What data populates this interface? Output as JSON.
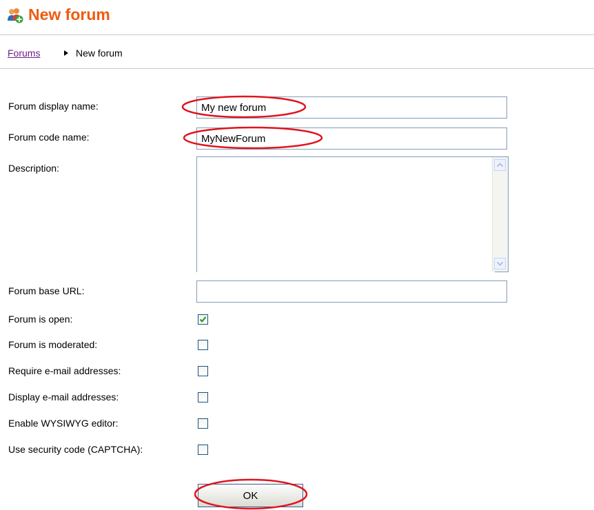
{
  "header": {
    "title": "New forum",
    "icon": "add-group-icon",
    "title_color": "#f05a0e"
  },
  "breadcrumb": {
    "link": "Forums",
    "separator_icon": "triangle-right-icon",
    "current": "New forum"
  },
  "form": {
    "display_name": {
      "label": "Forum display name:",
      "value": "My new forum"
    },
    "code_name": {
      "label": "Forum code name:",
      "value": "MyNewForum"
    },
    "description": {
      "label": "Description:",
      "value": ""
    },
    "base_url": {
      "label": "Forum base URL:",
      "value": ""
    },
    "checkboxes": [
      {
        "label": "Forum is open:",
        "checked": true
      },
      {
        "label": "Forum is moderated:",
        "checked": false
      },
      {
        "label": "Require e-mail addresses:",
        "checked": false
      },
      {
        "label": "Display e-mail addresses:",
        "checked": false
      },
      {
        "label": "Enable WYSIWYG editor:",
        "checked": false
      },
      {
        "label": "Use security code (CAPTCHA):",
        "checked": false
      }
    ],
    "ok_label": "OK"
  },
  "annotations": {
    "color": "#e0141e",
    "highlighted": [
      "forum-display-name-input",
      "forum-code-name-input",
      "ok-button"
    ]
  }
}
